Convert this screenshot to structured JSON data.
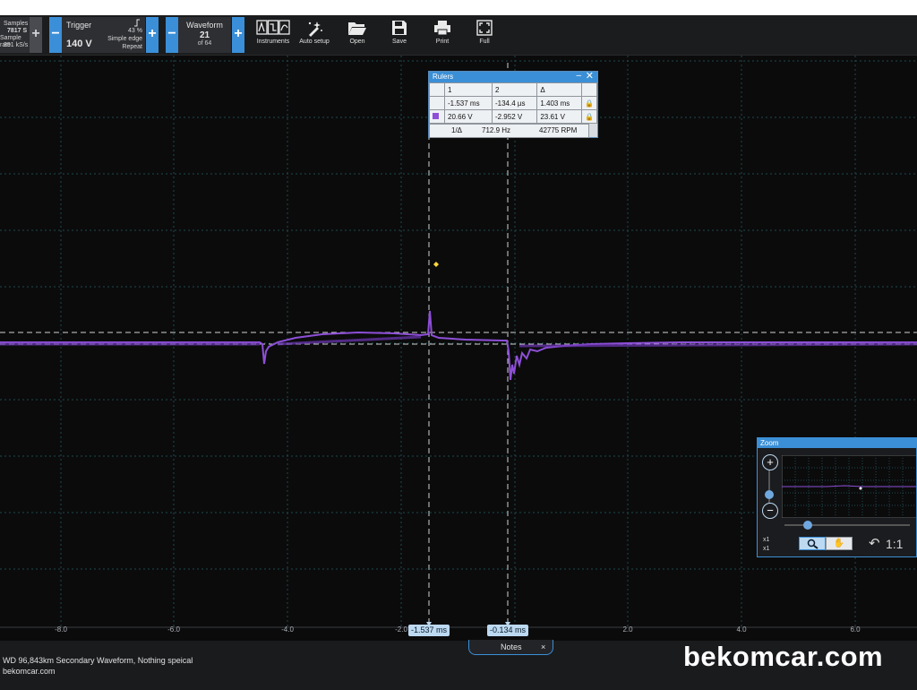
{
  "toolbar": {
    "samples": {
      "title": "Samples",
      "count": "7817 S",
      "rate_label": "Sample rate",
      "rate_value": "391 kS/s"
    },
    "trigger": {
      "title": "Trigger",
      "level": "140 V",
      "percent": "43 %",
      "mode": "Simple edge",
      "repeat": "Repeat"
    },
    "waveform": {
      "title": "Waveform",
      "index": "21",
      "of": "of 64"
    },
    "tools": [
      {
        "label": "Instruments",
        "icon": "instruments-icon"
      },
      {
        "label": "Auto setup",
        "icon": "auto-setup-icon"
      },
      {
        "label": "Open",
        "icon": "folder-open-icon"
      },
      {
        "label": "Save",
        "icon": "save-icon"
      },
      {
        "label": "Print",
        "icon": "printer-icon"
      },
      {
        "label": "Full",
        "icon": "fullscreen-icon"
      }
    ],
    "plus": "+",
    "minus": "−"
  },
  "rulers": {
    "title": "Rulers",
    "col1": "1",
    "col2": "2",
    "delta": "Δ",
    "time1": "-1.537 ms",
    "time2": "-134.4 µs",
    "time_delta": "1.403 ms",
    "volt1": "20.66 V",
    "volt2": "-2.952 V",
    "volt_delta": "23.61 V",
    "inv_label": "1/Δ",
    "freq": "712.9 Hz",
    "rpm": "42775 RPM"
  },
  "cursors": {
    "c1": "-1.537 ms",
    "c2": "-0.134 ms"
  },
  "x_ticks": [
    "-8.0",
    "-6.0",
    "-4.0",
    "-2.0",
    "2.0",
    "4.0",
    "6.0"
  ],
  "zoom": {
    "title": "Zoom",
    "x1a": "x1",
    "x1b": "x1",
    "ratio": "1:1"
  },
  "notes": {
    "label": "Notes",
    "close": "×"
  },
  "status": {
    "line1": "WD 96,843km Secondary Waveform, Nothing speical",
    "line2": "bekomcar.com"
  },
  "watermark": "bekomcar.com",
  "colors": {
    "accent": "#3b8fd6",
    "trace": "#8e4fd8",
    "grid": "#1f4a4c",
    "cursor": "#d0d0d0"
  }
}
